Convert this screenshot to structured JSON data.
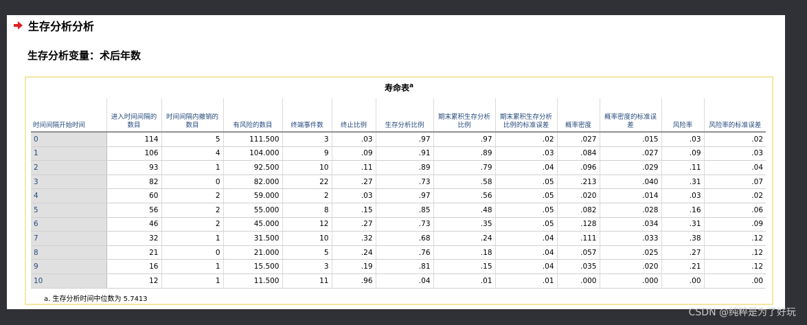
{
  "heading": {
    "title": "生存分析分析",
    "icon": "red-arrow-icon",
    "icon_color": "#e02020"
  },
  "subheading": "生存分析变量：术后年数",
  "table": {
    "title": "寿命表",
    "title_sup": "a",
    "headers": [
      "时间间隔开始时间",
      "进入时间间隔的数目",
      "时间间隔内撤销的数目",
      "有风险的数目",
      "终端事件数",
      "终止比例",
      "生存分析比例",
      "期末累积生存分析比例",
      "期末累积生存分析比例的标准误差",
      "概率密度",
      "概率密度的标准误差",
      "风险率",
      "风险率的标准误差"
    ],
    "rows": [
      [
        "0",
        "114",
        "5",
        "111.500",
        "3",
        ".03",
        ".97",
        ".97",
        ".02",
        ".027",
        ".015",
        ".03",
        ".02"
      ],
      [
        "1",
        "106",
        "4",
        "104.000",
        "9",
        ".09",
        ".91",
        ".89",
        ".03",
        ".084",
        ".027",
        ".09",
        ".03"
      ],
      [
        "2",
        "93",
        "1",
        "92.500",
        "10",
        ".11",
        ".89",
        ".79",
        ".04",
        ".096",
        ".029",
        ".11",
        ".04"
      ],
      [
        "3",
        "82",
        "0",
        "82.000",
        "22",
        ".27",
        ".73",
        ".58",
        ".05",
        ".213",
        ".040",
        ".31",
        ".07"
      ],
      [
        "4",
        "60",
        "2",
        "59.000",
        "2",
        ".03",
        ".97",
        ".56",
        ".05",
        ".020",
        ".014",
        ".03",
        ".02"
      ],
      [
        "5",
        "56",
        "2",
        "55.000",
        "8",
        ".15",
        ".85",
        ".48",
        ".05",
        ".082",
        ".028",
        ".16",
        ".06"
      ],
      [
        "6",
        "46",
        "2",
        "45.000",
        "12",
        ".27",
        ".73",
        ".35",
        ".05",
        ".128",
        ".034",
        ".31",
        ".09"
      ],
      [
        "7",
        "32",
        "1",
        "31.500",
        "10",
        ".32",
        ".68",
        ".24",
        ".04",
        ".111",
        ".033",
        ".38",
        ".12"
      ],
      [
        "8",
        "21",
        "0",
        "21.000",
        "5",
        ".24",
        ".76",
        ".18",
        ".04",
        ".057",
        ".025",
        ".27",
        ".12"
      ],
      [
        "9",
        "16",
        "1",
        "15.500",
        "3",
        ".19",
        ".81",
        ".15",
        ".04",
        ".035",
        ".020",
        ".21",
        ".12"
      ],
      [
        "10",
        "12",
        "1",
        "11.500",
        "11",
        ".96",
        ".04",
        ".01",
        ".01",
        ".000",
        ".000",
        ".00",
        ".00"
      ]
    ],
    "footnote": "a. 生存分析时间中位数为 5.7413"
  },
  "watermark": "CSDN @纯粹是为了好玩"
}
